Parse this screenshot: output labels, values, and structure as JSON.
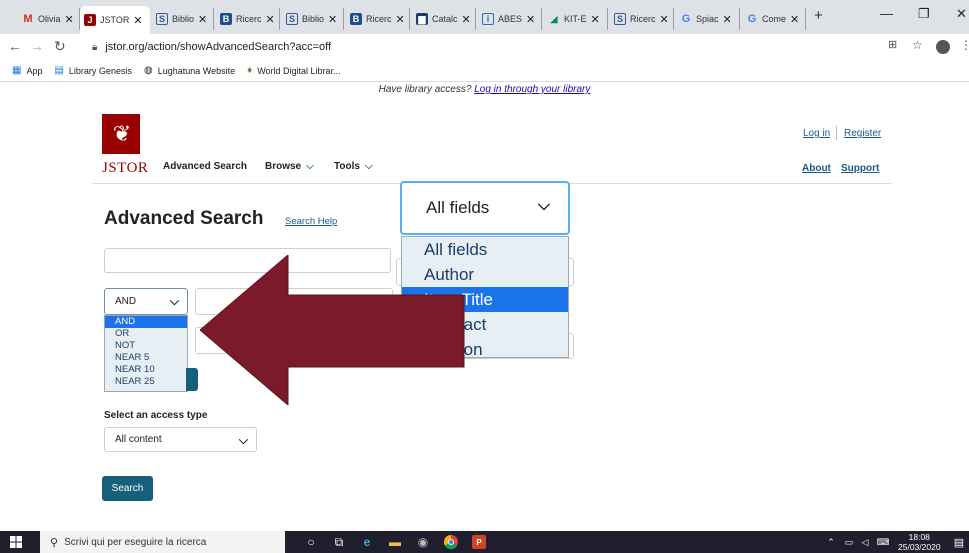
{
  "browser": {
    "tabs": [
      {
        "label": "Olivia",
        "icon": "gmail-icon",
        "color": "#d93025"
      },
      {
        "label": "JSTOR",
        "icon": "jstor-icon",
        "color": "#990000",
        "active": true
      },
      {
        "label": "Biblio",
        "icon": "s-icon",
        "color": "#3b5998"
      },
      {
        "label": "Ricerc",
        "icon": "b-icon",
        "color": "#1f4e8c"
      },
      {
        "label": "Biblio",
        "icon": "s-icon",
        "color": "#3b5998"
      },
      {
        "label": "Ricerc",
        "icon": "b-icon",
        "color": "#1f4e8c"
      },
      {
        "label": "Catalc",
        "icon": "catalog-icon",
        "color": "#1a3f6b"
      },
      {
        "label": "ABES",
        "icon": "abes-icon",
        "color": "#2a6fb0"
      },
      {
        "label": "KIT-E",
        "icon": "kit-icon",
        "color": "#0a8a5a"
      },
      {
        "label": "Ricerc",
        "icon": "s-icon",
        "color": "#3b5998"
      },
      {
        "label": "Spiac",
        "icon": "google-icon",
        "color": "#4285f4"
      },
      {
        "label": "Come",
        "icon": "google-icon",
        "color": "#4285f4"
      }
    ],
    "new_tab": "+",
    "url": "jstor.org/action/showAdvancedSearch?acc=off",
    "bookmarks": [
      {
        "label": "App",
        "icon": "apps-grid-icon"
      },
      {
        "label": "Library Genesis",
        "icon": "bookmark-icon"
      },
      {
        "label": "Lughatuna Website",
        "icon": "globe-icon"
      },
      {
        "label": "World Digital Librar...",
        "icon": "pin-icon"
      }
    ]
  },
  "page": {
    "banner_text": "Have library access?",
    "banner_link": "Log in through your library",
    "logo_text": "JSTOR",
    "nav": {
      "advanced": "Advanced Search",
      "browse": "Browse",
      "tools": "Tools"
    },
    "login": "Log in",
    "register": "Register",
    "about": "About",
    "support": "Support",
    "title": "Advanced Search",
    "search_help": "Search Help",
    "operator_selected": "AND",
    "operator_options": [
      "AND",
      "OR",
      "NOT",
      "NEAR 5",
      "NEAR 10",
      "NEAR 25"
    ],
    "field_selected": "All fields",
    "field_options": [
      "All fields",
      "Author",
      "Item Title",
      "Abstract",
      "Caption"
    ],
    "access_label": "Select an access type",
    "access_value": "All content",
    "search_button": "Search"
  },
  "taskbar": {
    "search_placeholder": "Scrivi qui per eseguire la ricerca",
    "time": "18:08",
    "date": "25/03/2020"
  },
  "colors": {
    "jstor_red": "#990000",
    "teal": "#16607c",
    "arrow": "#7b1a2a",
    "selection": "#1a73e8"
  }
}
